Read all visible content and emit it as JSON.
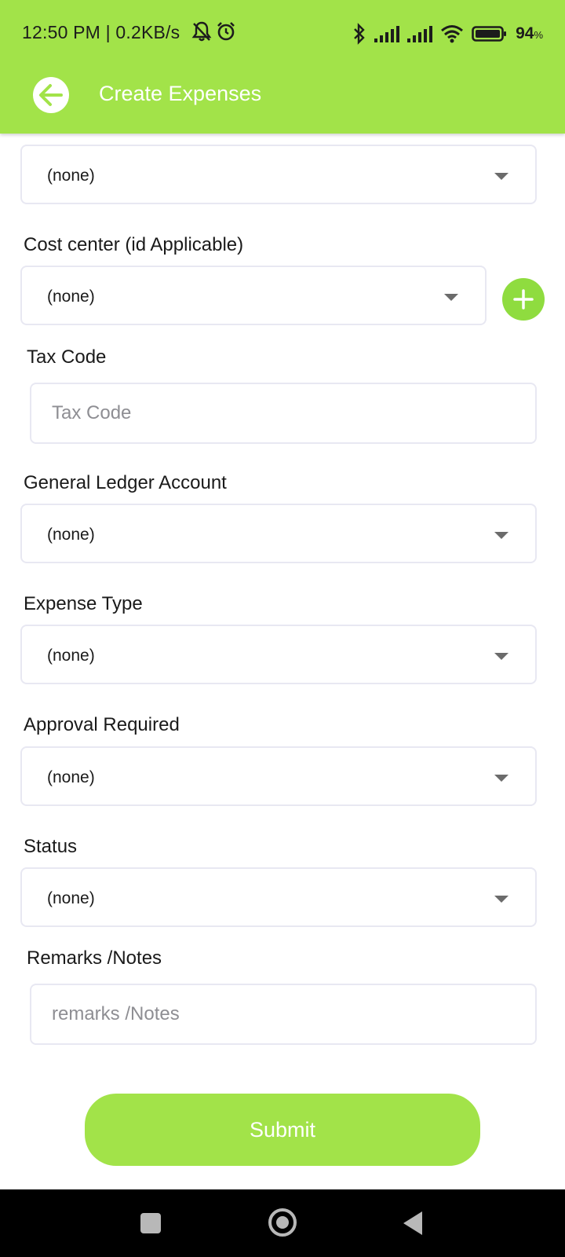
{
  "status_bar": {
    "time": "12:50 PM | 0.2KB/s",
    "battery": "94",
    "battery_unit": "%",
    "icons": [
      "mute-bell-icon",
      "alarm-icon",
      "bluetooth-icon",
      "signal-icon",
      "signal-icon",
      "wifi-icon",
      "battery-icon"
    ]
  },
  "header": {
    "title": "Create Expenses",
    "back_icon": "arrow-left-icon"
  },
  "form": {
    "top_select": {
      "value": "(none)"
    },
    "cost_center": {
      "label": "Cost center (id Applicable)",
      "value": "(none)",
      "add_icon": "plus-icon"
    },
    "tax_code": {
      "label": "Tax Code",
      "placeholder": "Tax Code"
    },
    "gl_account": {
      "label": "General Ledger Account",
      "value": "(none)"
    },
    "expense_type": {
      "label": "Expense Type",
      "value": "(none)"
    },
    "approval_required": {
      "label": "Approval Required",
      "value": "(none)"
    },
    "status": {
      "label": "Status",
      "value": "(none)"
    },
    "remarks": {
      "label": "Remarks /Notes",
      "placeholder": "remarks /Notes"
    },
    "submit_label": "Submit"
  },
  "nav_bar": {
    "icons": [
      "recent-apps-icon",
      "home-icon",
      "back-icon"
    ]
  },
  "colors": {
    "accent": "#a2e349",
    "add_button": "#8fdc3f"
  }
}
